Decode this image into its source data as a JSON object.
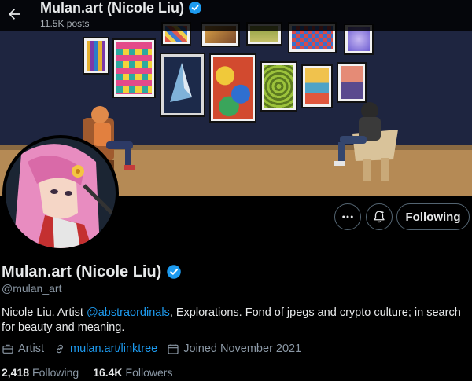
{
  "header": {
    "back_icon": "arrow-left-icon",
    "name": "Mulan.art (Nicole Liu)",
    "verified_icon": "verified-badge-icon",
    "posts_count": "11.5K posts"
  },
  "actions": {
    "more_icon": "more-horizontal-icon",
    "notify_icon": "bell-plus-icon",
    "following_label": "Following"
  },
  "profile": {
    "display_name": "Mulan.art (Nicole Liu)",
    "handle": "@mulan_art",
    "bio_prefix": "Nicole Liu. Artist ",
    "bio_mention": "@abstraordinals",
    "bio_suffix": ", Explorations. Fond of jpegs and crypto culture; in search for beauty and meaning.",
    "category": "Artist",
    "link": "mulan.art/linktree",
    "joined": "Joined November 2021"
  },
  "stats": {
    "following_count": "2,418",
    "following_label": "Following",
    "followers_count": "16.4K",
    "followers_label": "Followers"
  },
  "colors": {
    "accent": "#1d9bf0",
    "background": "#000000",
    "text": "#e7e9ea",
    "muted": "#8b98a5"
  }
}
